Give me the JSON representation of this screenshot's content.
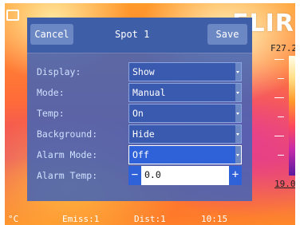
{
  "brand": {
    "text": "FLIR"
  },
  "thermal": {
    "scale_high": "F27.2",
    "scale_low": "19.0"
  },
  "status": {
    "unit": "°C",
    "emiss": "Emiss:1",
    "dist": "Dist:1",
    "time": "10:15"
  },
  "dialog": {
    "cancel_label": "Cancel",
    "title": "Spot 1",
    "save_label": "Save",
    "rows": [
      {
        "label": "Display:",
        "value": "Show"
      },
      {
        "label": "Mode:",
        "value": "Manual"
      },
      {
        "label": "Temp:",
        "value": "On"
      },
      {
        "label": "Background:",
        "value": "Hide"
      },
      {
        "label": "Alarm Mode:",
        "value": "Off"
      },
      {
        "label": "Alarm Temp:",
        "value": "0.0",
        "minus": "−",
        "plus": "+"
      }
    ]
  }
}
